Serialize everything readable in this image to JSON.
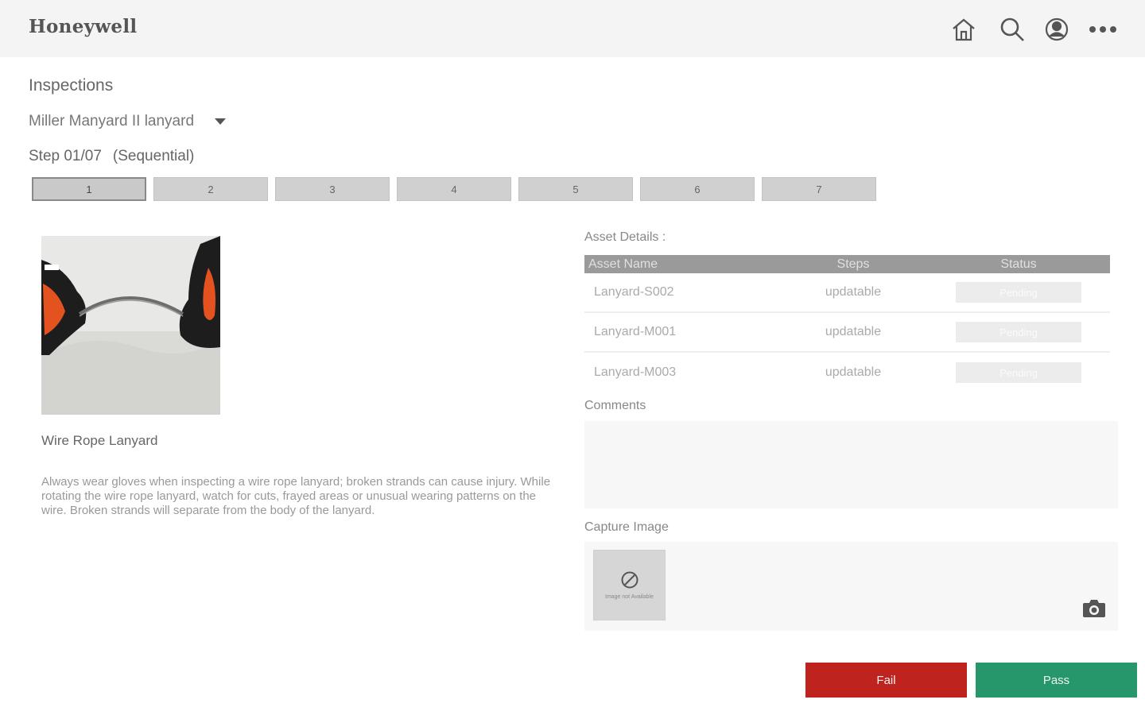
{
  "header": {
    "brand": "Honeywell",
    "icons": [
      "home-icon",
      "search-icon",
      "user-icon",
      "more-icon"
    ]
  },
  "page": {
    "title": "Inspections",
    "selected_item": "Miller Manyard II lanyard",
    "step_label": "Step 01/07",
    "step_mode": "(Sequential)",
    "steps": [
      "1",
      "2",
      "3",
      "4",
      "5",
      "6",
      "7"
    ],
    "active_step": 1
  },
  "item": {
    "title": "Wire Rope Lanyard",
    "description": "Always wear gloves when inspecting a wire rope lanyard; broken strands can cause injury. While rotating the wire rope lanyard, watch for cuts, frayed areas or unusual wearing patterns on the wire. Broken strands will separate from the body of the lanyard."
  },
  "assets": {
    "label": "Asset Details :",
    "columns": [
      "Asset Name",
      "Steps",
      "Status"
    ],
    "rows": [
      {
        "name": "Lanyard-S002",
        "steps": "updatable",
        "status": "Pending"
      },
      {
        "name": "Lanyard-M001",
        "steps": "updatable",
        "status": "Pending"
      },
      {
        "name": "Lanyard-M003",
        "steps": "updatable",
        "status": "Pending"
      }
    ]
  },
  "comments": {
    "label": "Comments",
    "value": ""
  },
  "capture": {
    "label": "Capture Image",
    "placeholder_text": "Image not Available"
  },
  "actions": {
    "fail": "Fail",
    "pass": "Pass"
  },
  "colors": {
    "fail": "#bf231e",
    "pass": "#26976b",
    "header_bg": "#f4f4f4"
  }
}
